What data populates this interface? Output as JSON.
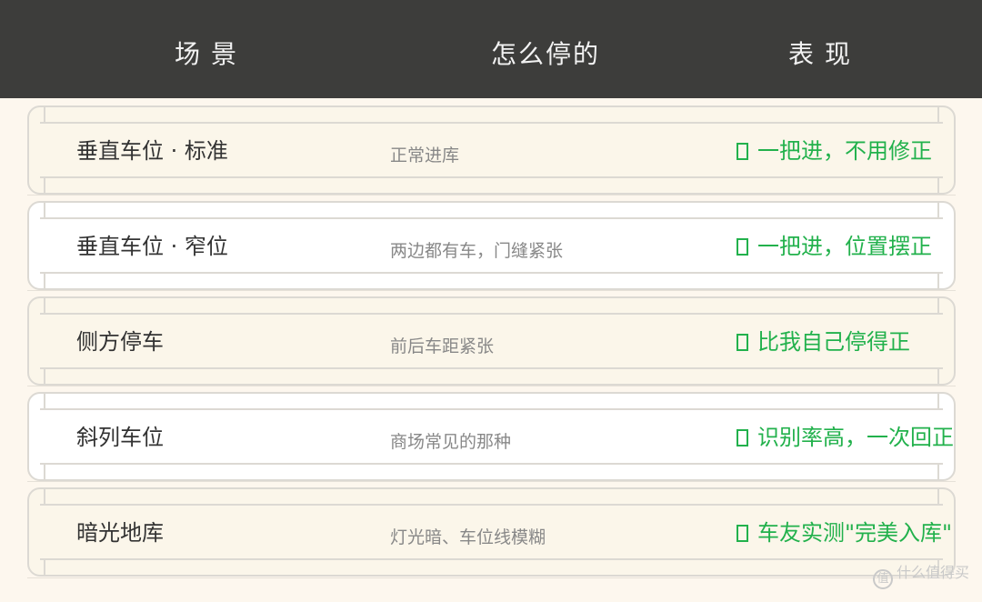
{
  "header": {
    "col_scene": "场景",
    "col_how": "怎么停的",
    "col_performance": "表现"
  },
  "rows": [
    {
      "scene": "垂直车位 · 标准",
      "how": "正常进库",
      "performance": "一把进，不用修正"
    },
    {
      "scene": "垂直车位 · 窄位",
      "how": "两边都有车，门缝紧张",
      "performance": "一把进，位置摆正"
    },
    {
      "scene": "侧方停车",
      "how": "前后车距紧张",
      "performance": "比我自己停得正"
    },
    {
      "scene": "斜列车位",
      "how": "商场常见的那种",
      "performance": "识别率高，一次回正"
    },
    {
      "scene": "暗光地库",
      "how": "灯光暗、车位线模糊",
      "performance": "车友实测\"完美入库\""
    }
  ],
  "watermark": {
    "text": "什么值得买",
    "logo_char": "值"
  },
  "colors": {
    "header_bg": "#3d3d3b",
    "header_text": "#f2f2f2",
    "page_bg": "#fdf7ee",
    "scene_text": "#333333",
    "how_text": "#888888",
    "performance_text": "#22b14c"
  }
}
